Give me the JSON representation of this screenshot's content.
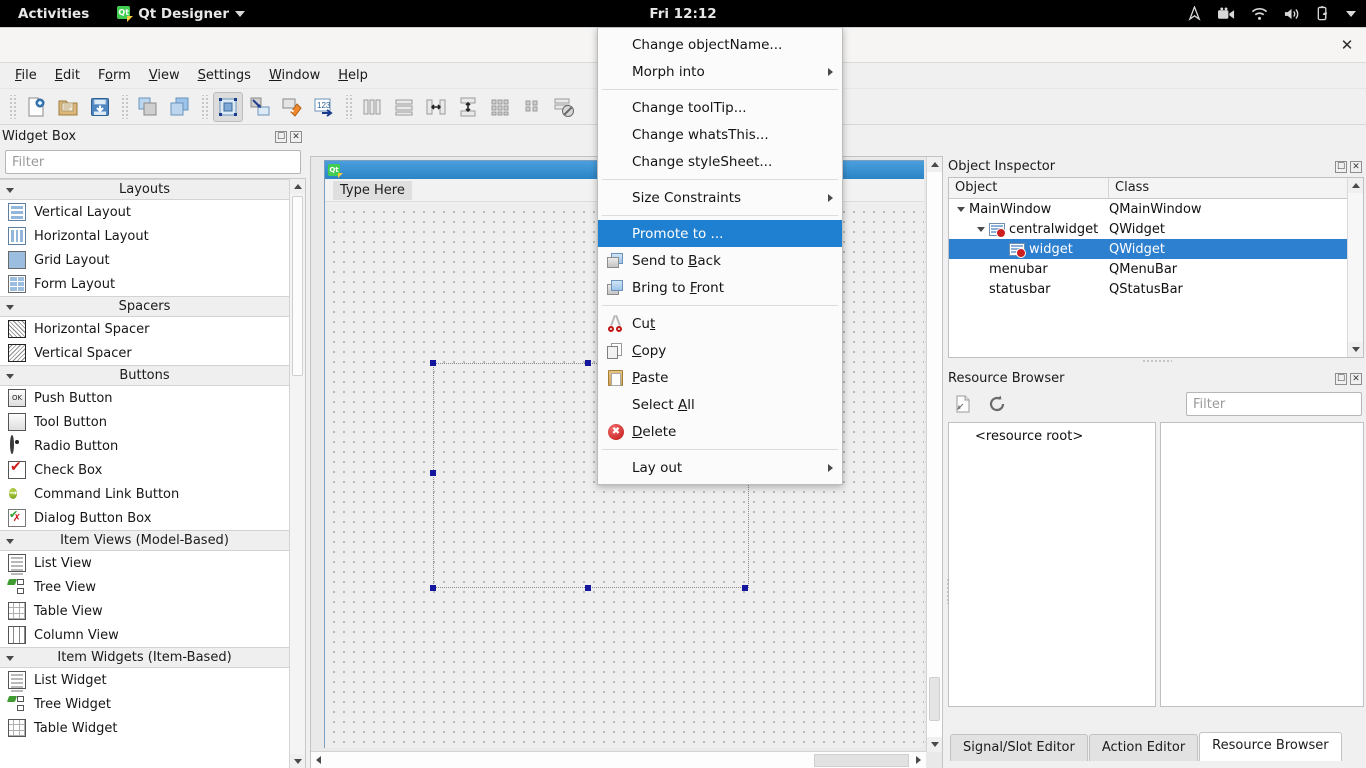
{
  "topbar": {
    "activities": "Activities",
    "app_name": "Qt Designer",
    "qt_logo_text": "Qt",
    "clock": "Fri 12:12",
    "tray_icons": [
      "location-icon",
      "screencast-icon",
      "wifi-icon",
      "volume-icon",
      "battery-icon",
      "caret-down-icon"
    ]
  },
  "window": {
    "close_label": "✕"
  },
  "menubar": {
    "items": [
      {
        "pre": "",
        "mn": "F",
        "post": "ile"
      },
      {
        "pre": "",
        "mn": "E",
        "post": "dit"
      },
      {
        "pre": "F",
        "mn": "o",
        "post": "rm"
      },
      {
        "pre": "",
        "mn": "V",
        "post": "iew"
      },
      {
        "pre": "",
        "mn": "S",
        "post": "ettings"
      },
      {
        "pre": "",
        "mn": "W",
        "post": "indow"
      },
      {
        "pre": "",
        "mn": "H",
        "post": "elp"
      }
    ]
  },
  "toolbar": {
    "buttons": [
      {
        "name": "new-form-button",
        "active": false
      },
      {
        "name": "open-form-button",
        "active": false
      },
      {
        "name": "save-form-button",
        "active": false
      },
      {
        "name": "edit-widgets-button",
        "active": false
      },
      {
        "name": "edit-buddies-button",
        "active": false
      },
      {
        "name": "edit-widget-mode-button",
        "active": true
      },
      {
        "name": "edit-signals-slots-button",
        "active": false
      },
      {
        "name": "edit-buddies-mode-button",
        "active": false
      },
      {
        "name": "edit-tab-order-button",
        "active": false
      },
      {
        "name": "layout-horizontally-button",
        "active": false
      },
      {
        "name": "layout-vertically-button",
        "active": false
      },
      {
        "name": "layout-splitter-horizontal-button",
        "active": false
      },
      {
        "name": "layout-splitter-vertical-button",
        "active": false
      },
      {
        "name": "layout-grid-button",
        "active": false
      },
      {
        "name": "layout-form-button",
        "active": false
      },
      {
        "name": "break-layout-button",
        "active": false
      }
    ]
  },
  "widget_box": {
    "title": "Widget Box",
    "filter_placeholder": "Filter",
    "dock_buttons": [
      "float-icon",
      "close-icon"
    ],
    "categories": [
      {
        "label": "Layouts",
        "items": [
          {
            "label": "Vertical Layout",
            "icon": "vertical-layout-icon"
          },
          {
            "label": "Horizontal Layout",
            "icon": "horizontal-layout-icon"
          },
          {
            "label": "Grid Layout",
            "icon": "grid-layout-icon"
          },
          {
            "label": "Form Layout",
            "icon": "form-layout-icon"
          }
        ]
      },
      {
        "label": "Spacers",
        "items": [
          {
            "label": "Horizontal Spacer",
            "icon": "horizontal-spacer-icon"
          },
          {
            "label": "Vertical Spacer",
            "icon": "vertical-spacer-icon"
          }
        ]
      },
      {
        "label": "Buttons",
        "items": [
          {
            "label": "Push Button",
            "icon": "push-button-icon"
          },
          {
            "label": "Tool Button",
            "icon": "tool-button-icon"
          },
          {
            "label": "Radio Button",
            "icon": "radio-button-icon"
          },
          {
            "label": "Check Box",
            "icon": "check-box-icon"
          },
          {
            "label": "Command Link Button",
            "icon": "command-link-button-icon"
          },
          {
            "label": "Dialog Button Box",
            "icon": "dialog-button-box-icon"
          }
        ]
      },
      {
        "label": "Item Views (Model-Based)",
        "items": [
          {
            "label": "List View",
            "icon": "list-view-icon"
          },
          {
            "label": "Tree View",
            "icon": "tree-view-icon"
          },
          {
            "label": "Table View",
            "icon": "table-view-icon"
          },
          {
            "label": "Column View",
            "icon": "column-view-icon"
          }
        ]
      },
      {
        "label": "Item Widgets (Item-Based)",
        "items": [
          {
            "label": "List Widget",
            "icon": "list-widget-icon"
          },
          {
            "label": "Tree Widget",
            "icon": "tree-widget-icon"
          },
          {
            "label": "Table Widget",
            "icon": "table-widget-icon"
          }
        ]
      }
    ]
  },
  "form": {
    "titlebar_icon": "qt-designer-form-icon",
    "qt_logo_text": "Qt",
    "menubar_hint": "Type Here"
  },
  "context_menu": {
    "selected_item": "Promote to ...",
    "items": [
      {
        "label": "Change objectName...",
        "icon": null,
        "submenu": false,
        "mn": null
      },
      {
        "label": "Morph into",
        "icon": null,
        "submenu": true,
        "mn": null
      },
      {
        "separator": true
      },
      {
        "label": "Change toolTip...",
        "icon": null,
        "submenu": false
      },
      {
        "label": "Change whatsThis...",
        "icon": null,
        "submenu": false
      },
      {
        "label": "Change styleSheet...",
        "icon": null,
        "submenu": false
      },
      {
        "separator": true
      },
      {
        "label": "Size Constraints",
        "icon": null,
        "submenu": true
      },
      {
        "separator": true
      },
      {
        "label": "Promote to ...",
        "icon": null,
        "submenu": false,
        "selected": true
      },
      {
        "label": "Send to Back",
        "icon": "send-to-back-icon",
        "submenu": false,
        "pre": "Send to ",
        "mn": "B",
        "post": "ack"
      },
      {
        "label": "Bring to Front",
        "icon": "bring-to-front-icon",
        "submenu": false,
        "pre": "Bring to ",
        "mn": "F",
        "post": "ront"
      },
      {
        "separator": true
      },
      {
        "label": "Cut",
        "icon": "cut-icon",
        "submenu": false,
        "pre": "Cu",
        "mn": "t",
        "post": ""
      },
      {
        "label": "Copy",
        "icon": "copy-icon",
        "submenu": false,
        "pre": "",
        "mn": "C",
        "post": "opy"
      },
      {
        "label": "Paste",
        "icon": "paste-icon",
        "submenu": false,
        "pre": "",
        "mn": "P",
        "post": "aste"
      },
      {
        "label": "Select All",
        "icon": null,
        "submenu": false,
        "pre": "Select ",
        "mn": "A",
        "post": "ll"
      },
      {
        "label": "Delete",
        "icon": "delete-icon",
        "submenu": false,
        "pre": "",
        "mn": "D",
        "post": "elete"
      },
      {
        "separator": true
      },
      {
        "label": "Lay out",
        "icon": null,
        "submenu": true
      }
    ]
  },
  "object_inspector": {
    "title": "Object Inspector",
    "dock_buttons": [
      "float-icon",
      "close-icon"
    ],
    "columns": [
      "Object",
      "Class"
    ],
    "rows": [
      {
        "object": "MainWindow",
        "class": "QMainWindow",
        "depth": 0,
        "caret": true,
        "icon": false,
        "selected": false
      },
      {
        "object": "centralwidget",
        "class": "QWidget",
        "depth": 1,
        "caret": true,
        "icon": true,
        "selected": false
      },
      {
        "object": "widget",
        "class": "QWidget",
        "depth": 2,
        "caret": false,
        "icon": true,
        "selected": true
      },
      {
        "object": "menubar",
        "class": "QMenuBar",
        "depth": 1,
        "caret": false,
        "icon": false,
        "selected": false
      },
      {
        "object": "statusbar",
        "class": "QStatusBar",
        "depth": 1,
        "caret": false,
        "icon": false,
        "selected": false
      }
    ]
  },
  "resource_browser": {
    "title": "Resource Browser",
    "dock_buttons": [
      "float-icon",
      "close-icon"
    ],
    "toolbuttons": [
      "edit-resources-icon",
      "reload-icon"
    ],
    "filter_placeholder": "Filter",
    "root_label": "<resource root>"
  },
  "bottom_tabs": [
    {
      "label": "Signal/Slot Editor",
      "active": false
    },
    {
      "label": "Action Editor",
      "active": false
    },
    {
      "label": "Resource Browser",
      "active": true
    }
  ],
  "colors": {
    "selection_blue": "#1f7fd0",
    "tree_selection_blue": "#2d7fd0",
    "form_titlebar_blue": "#2b84c7",
    "handle_navy": "#14179e",
    "qt_green": "#41cd52"
  }
}
